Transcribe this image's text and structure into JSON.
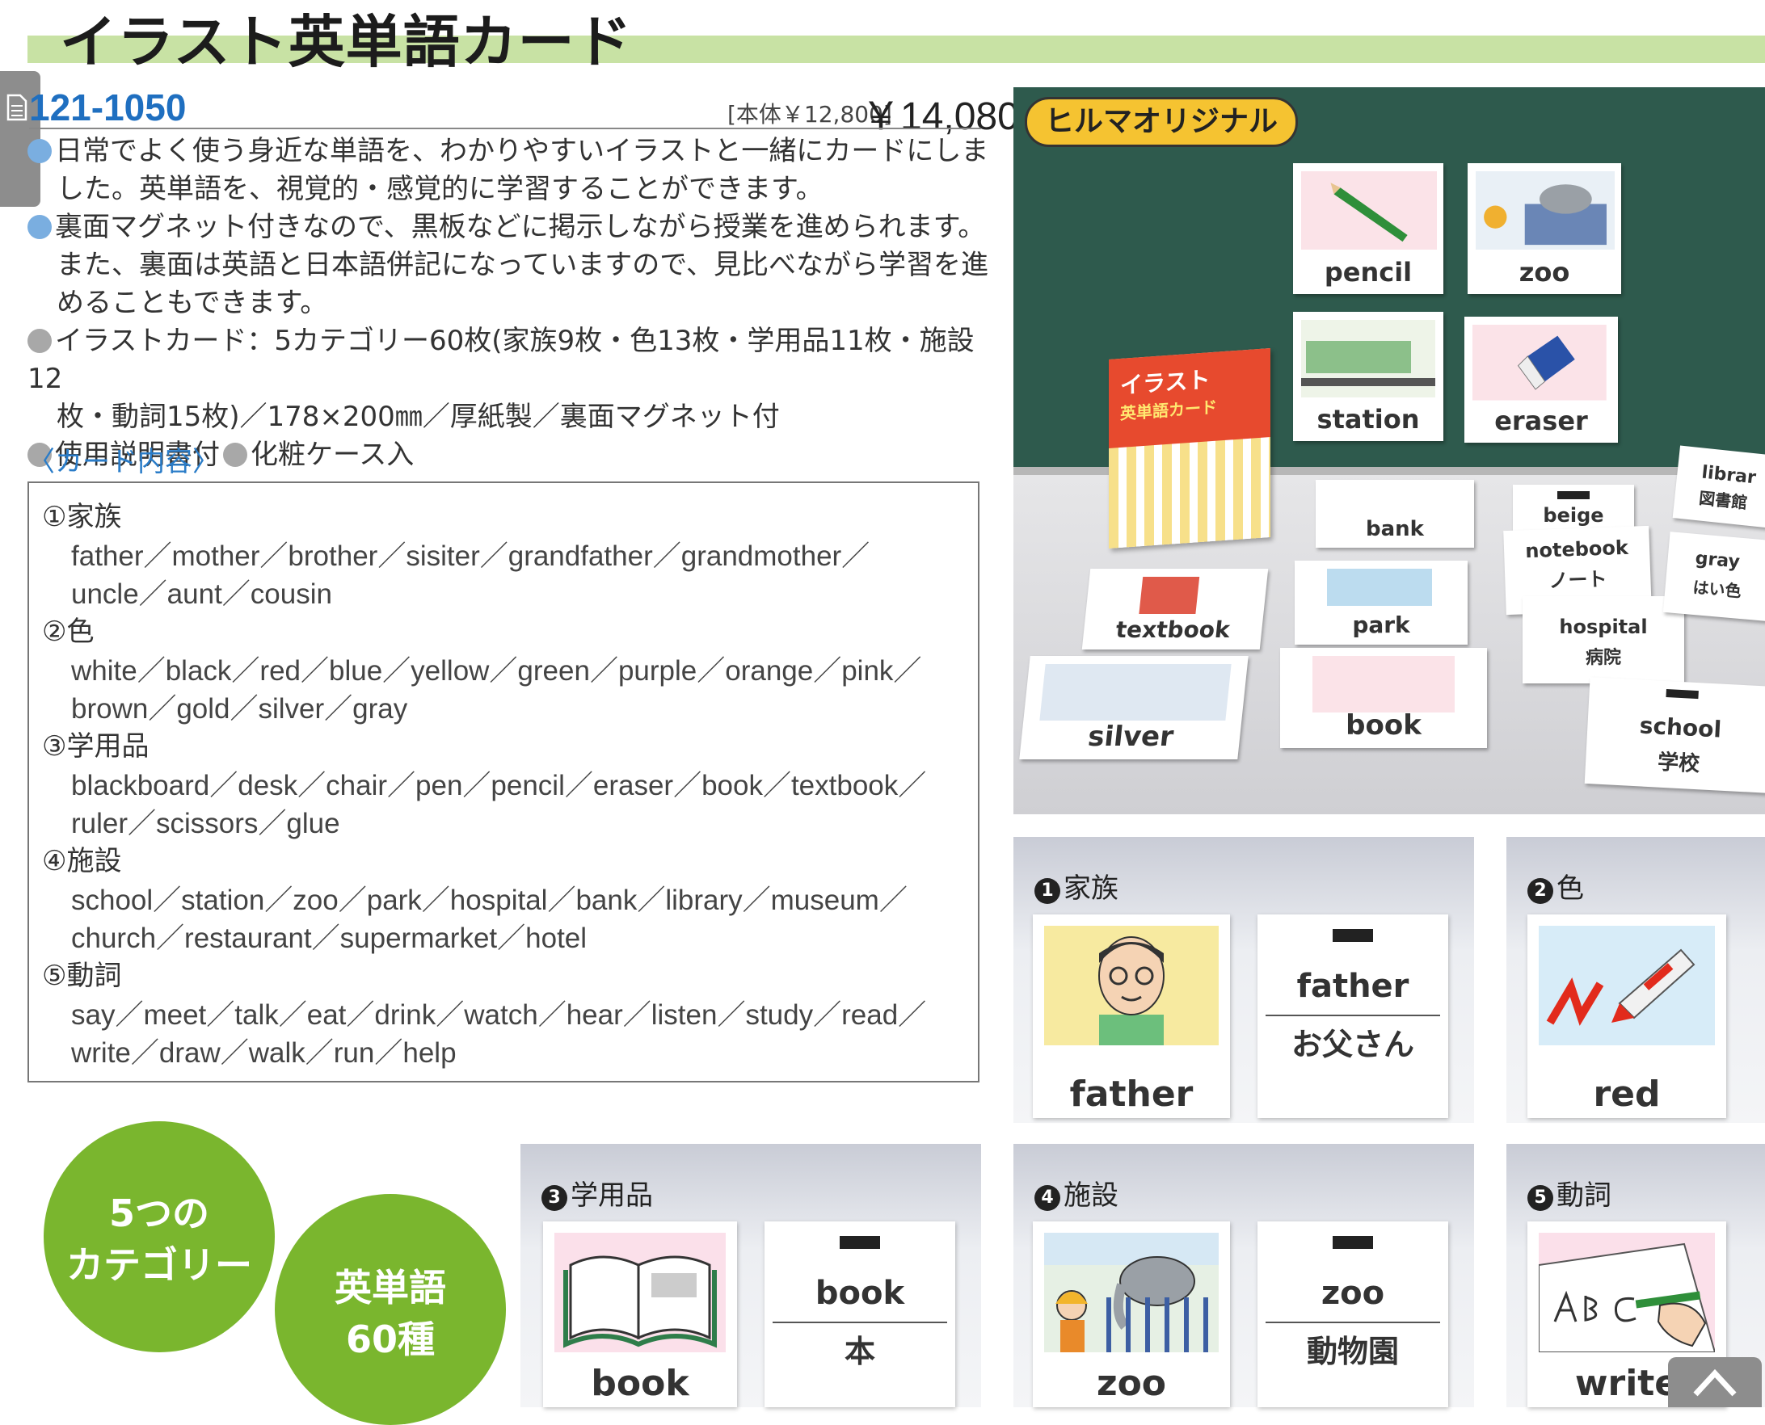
{
  "header": {
    "title": "イラスト英単語カード"
  },
  "product": {
    "code": "121-1050",
    "price_note": "[本体￥12,800]",
    "price": "￥14,080"
  },
  "description": {
    "p1_line1": "日常でよく使う身近な単語を、わかりやすいイラストと一緒にカードにしま",
    "p1_line2": "した。英単語を、視覚的・感覚的に学習することができます。",
    "p2_line1": "裏面マグネット付きなので、黒板などに掲示しながら授業を進められます。",
    "p2_line2": "また、裏面は英語と日本語併記になっていますので、見比べながら学習を進",
    "p2_line3": "めることもできます。",
    "spec_line1": "イラストカード：5カテゴリー60枚(家族9枚・色13枚・学用品11枚・施設12",
    "spec_line2": "枚・動詞15枚)／178×200㎜／厚紙製／裏面マグネット付",
    "spec_line3a": "使用説明書付",
    "spec_line3b": "化粧ケース入"
  },
  "card_contents_label": "〈カード内容〉",
  "word_list": [
    {
      "heading": "①家族",
      "lines": [
        "father／mother／brother／sisiter／grandfather／grandmother／",
        "uncle／aunt／cousin"
      ]
    },
    {
      "heading": "②色",
      "lines": [
        "white／black／red／blue／yellow／green／purple／orange／pink／",
        "brown／gold／silver／gray"
      ]
    },
    {
      "heading": "③学用品",
      "lines": [
        "blackboard／desk／chair／pen／pencil／eraser／book／textbook／",
        "ruler／scissors／glue"
      ]
    },
    {
      "heading": "④施設",
      "lines": [
        "school／station／zoo／park／hospital／bank／library／museum／",
        "church／restaurant／supermarket／hotel"
      ]
    },
    {
      "heading": "⑤動詞",
      "lines": [
        "say／meet／talk／eat／drink／watch／hear／listen／study／read／",
        "write／draw／walk／run／help"
      ]
    }
  ],
  "photo": {
    "badge": "ヒルマオリジナル",
    "box_title_1": "イラスト",
    "box_title_2": "英単語カード",
    "board_cards": [
      "pencil",
      "zoo",
      "station",
      "eraser"
    ],
    "table_cards": [
      "bank",
      "textbook",
      "park",
      "silver",
      "book"
    ],
    "back_cards": [
      {
        "en": "beige",
        "ja": ""
      },
      {
        "en": "notebook",
        "ja": "ノート"
      },
      {
        "en": "hospital",
        "ja": "病院"
      },
      {
        "en": "school",
        "ja": "学校"
      },
      {
        "en": "librar",
        "ja": "図書館"
      },
      {
        "en": "gray",
        "ja": "はい色"
      }
    ]
  },
  "categories": {
    "family": {
      "num": "1",
      "name": "家族",
      "front": "father",
      "back_en": "father",
      "back_ja": "お父さん"
    },
    "color": {
      "num": "2",
      "name": "色",
      "front": "red"
    },
    "school": {
      "num": "3",
      "name": "学用品",
      "front": "book",
      "back_en": "book",
      "back_ja": "本"
    },
    "facility": {
      "num": "4",
      "name": "施設",
      "front": "zoo",
      "back_en": "zoo",
      "back_ja": "動物園"
    },
    "verb": {
      "num": "5",
      "name": "動詞",
      "front": "write"
    }
  },
  "badges": {
    "five_line1": "5つの",
    "five_line2": "カテゴリー",
    "words_line1": "英単語",
    "words_line2": "60種"
  },
  "colors": {
    "accent_green": "#7ab62e",
    "title_band": "#c8e2a4",
    "link_blue": "#1f6fc0"
  },
  "icons": [
    "document-icon",
    "chevron-up-icon"
  ]
}
